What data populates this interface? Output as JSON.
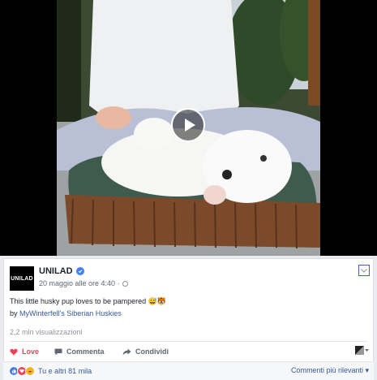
{
  "post": {
    "page_name": "UNILAD",
    "logo_text": "UNILAD",
    "timestamp": "20 maggio alle ore 4:40 · ",
    "text": "This little husky pup loves to be pampered 😅🐯",
    "by_prefix": "by ",
    "by_link": "MyWinterfell's Siberian Huskies",
    "views": "2,2 mln visualizzazioni"
  },
  "actions": {
    "love": "Love",
    "comment": "Commenta",
    "share": "Condividi"
  },
  "reactions": {
    "summary": "Tu e altri 81 mila",
    "sort": "Commenti più rilevanti ▾"
  },
  "icons": {
    "play": "play-icon",
    "verified": "verified-badge-icon",
    "options": "chevron-down-icon",
    "globe": "globe-icon",
    "love": "heart-icon",
    "comment": "comment-icon",
    "share": "share-arrow-icon"
  },
  "colors": {
    "love": "#f33e58",
    "link": "#365899",
    "accent": "#4267b2"
  }
}
